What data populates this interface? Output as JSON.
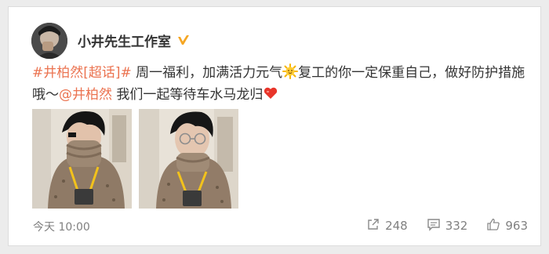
{
  "post": {
    "author": "小井先生工作室",
    "verified_color": "#f5a623",
    "content": {
      "topic_tag": "#井柏然[超话]#",
      "text_1": " 周一福利，加满活力元气",
      "text_2": "复工的你一定保重自己，做好防护措施哦～",
      "mention": "@井柏然",
      "text_3": " 我们一起等待车水马龙归"
    },
    "emojis": [
      "sun-emoji",
      "heart-emoji"
    ],
    "images": [
      "photo-1",
      "photo-2"
    ],
    "timestamp": "今天 10:00",
    "actions": {
      "share_count": "248",
      "comment_count": "332",
      "like_count": "963"
    }
  },
  "colors": {
    "link": "#eb7350",
    "text": "#333333",
    "muted": "#808080"
  }
}
